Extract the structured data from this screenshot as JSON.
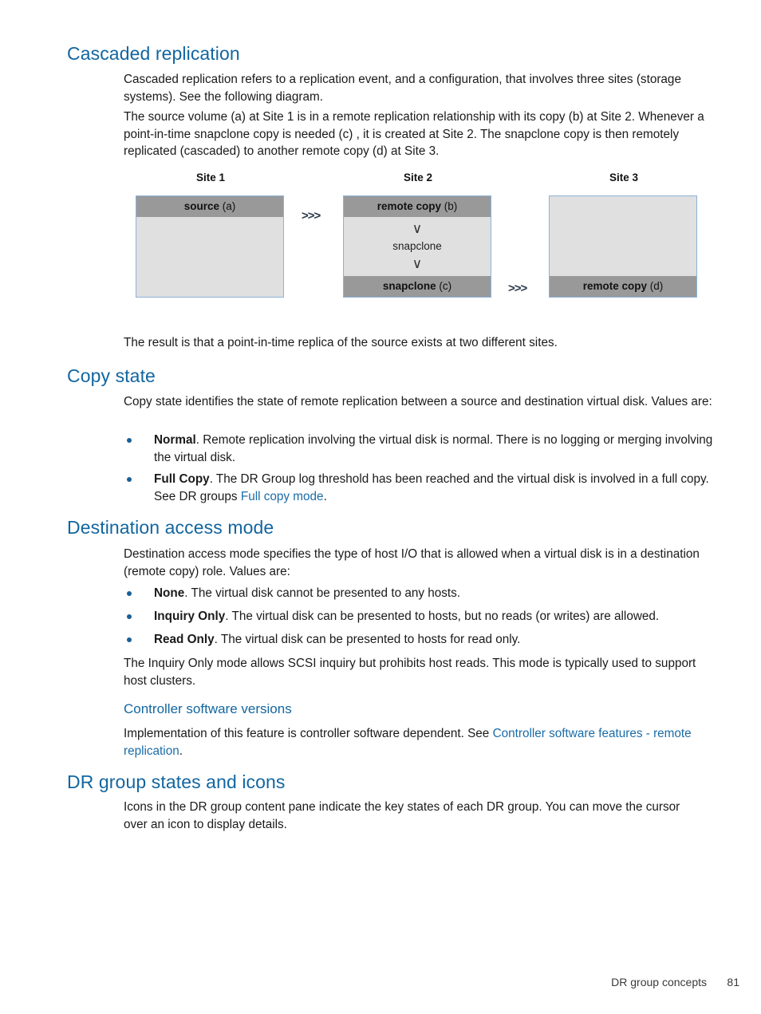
{
  "page": {
    "footer_text": "DR group concepts",
    "footer_page_number": "81",
    "heading_color": "#1266a0",
    "link_color": "#1a6ca8"
  },
  "sections": {
    "cascaded": {
      "title": "Cascaded replication",
      "para1": "Cascaded replication refers to a replication event, and a configuration, that involves three sites (storage systems). See the following diagram.",
      "para2": "The source volume (a) at Site 1 is in a remote replication relationship with its copy (b) at Site 2. Whenever a point-in-time snapclone copy is needed (c) , it is created at Site 2. The snapclone copy is then remotely replicated (cascaded) to another remote copy (d) at Site 3.",
      "result_para": "The result is that a point-in-time replica of the source exists at two different sites."
    },
    "copy_state": {
      "title": "Copy state",
      "intro": "Copy state identifies the state of remote replication between a source and destination virtual disk. Values are:",
      "bullets": [
        {
          "term": "Normal",
          "rest": ". Remote replication involving the virtual disk is normal. There is no logging or merging involving the virtual disk."
        },
        {
          "term": "Full Copy",
          "rest_before_link": ". The DR Group log threshold has been reached and the virtual disk is involved in a full copy. See DR groups ",
          "link": "Full copy mode",
          "rest_after_link": "."
        }
      ]
    },
    "destination_access": {
      "title": "Destination access mode",
      "intro": "Destination access mode specifies the type of host I/O that is allowed when a virtual disk is in a destination (remote copy) role. Values are:",
      "bullets": [
        {
          "term": "None",
          "rest": ". The virtual disk cannot be presented to any hosts."
        },
        {
          "term": "Inquiry Only",
          "rest": ". The virtual disk can be presented to hosts, but no reads (or writes) are allowed."
        },
        {
          "term": "Read Only",
          "rest": ". The virtual disk can be presented to hosts for read only."
        }
      ],
      "closing": "The Inquiry Only mode allows SCSI inquiry but prohibits host reads. This mode is typically used to support host clusters."
    },
    "controller_versions": {
      "title": "Controller software versions",
      "text_before_link": "Implementation of this feature is controller software dependent. See ",
      "link": "Controller software features - remote replication",
      "text_after_link": "."
    },
    "dr_group_states": {
      "title": "DR group states and icons",
      "para": "Icons in the DR group content pane indicate the key states of each DR group. You can move the cursor over an icon to display details."
    }
  },
  "diagram": {
    "arrow_glyph": ">>>",
    "chevron_glyph": "∨",
    "band_color": "#999999",
    "body_color": "#e0e0e0",
    "border_color": "#8bb3d9",
    "sites": [
      {
        "label": "Site 1",
        "header": {
          "term": "source",
          "paren": " (a)"
        },
        "footer": null,
        "inner": null
      },
      {
        "label": "Site 2",
        "header": {
          "term": "remote copy",
          "paren": " (b)"
        },
        "footer": {
          "term": "snapclone",
          "paren": " (c)"
        },
        "inner": "snapclone"
      },
      {
        "label": "Site 3",
        "header": null,
        "footer": {
          "term": "remote copy",
          "paren": " (d)"
        },
        "inner": null
      }
    ]
  }
}
